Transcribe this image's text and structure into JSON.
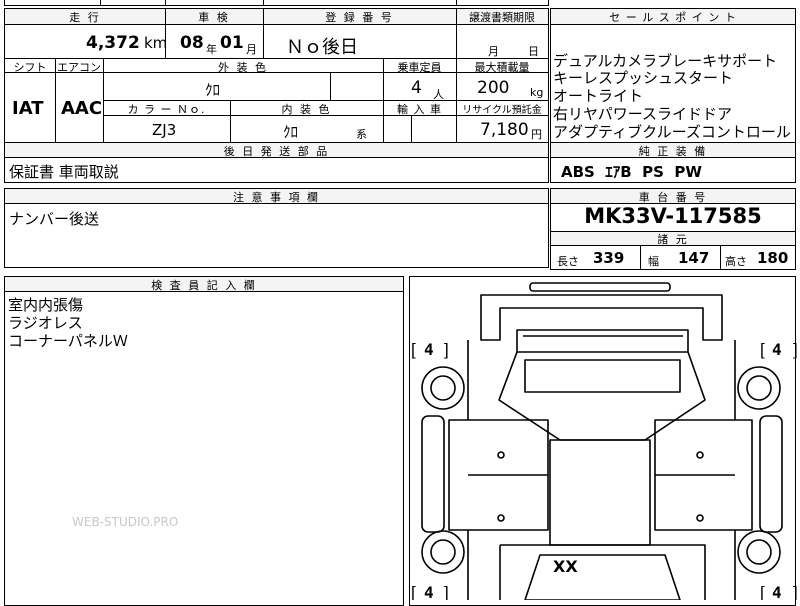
{
  "header": {
    "mileage_label": "走 行",
    "inspection_label": "車 検",
    "registration_label": "登 録 番 号",
    "transfer_label": "譲渡書類期限",
    "sales_point_label": "セ ー ル ス ポ イ ン ト"
  },
  "mileage": {
    "value": "4,372",
    "unit": "km"
  },
  "inspection": {
    "year": "08",
    "year_unit": "年",
    "month": "01",
    "month_unit": "月"
  },
  "registration": {
    "value": "Ｎｏ後日"
  },
  "transfer": {
    "month_unit": "月",
    "day_unit": "日"
  },
  "shift": {
    "label": "シフト",
    "value": "IAT"
  },
  "aircon": {
    "label": "エアコン",
    "value": "AAC"
  },
  "exterior": {
    "label": "外 装 色",
    "value": "ｸﾛ"
  },
  "capacity": {
    "label": "乗車定員",
    "value": "4",
    "unit": "人"
  },
  "max_load": {
    "label": "最大積載量",
    "value": "200",
    "unit": "kg"
  },
  "color_no": {
    "label": "カ ラ ー Ｎｏ.",
    "value": "ZJ3"
  },
  "interior": {
    "label": "内 装 色",
    "value": "ｸﾛ",
    "suffix": "系"
  },
  "import": {
    "label": "輸 入 車"
  },
  "recycle": {
    "label": "リサイクル預託金",
    "value": "7,180",
    "unit": "円"
  },
  "sales_points": [
    "デュアルカメラブレーキサポート",
    "キーレスプッシュスタート",
    "オートライト",
    "右リヤパワースライドドア",
    "アダプティブクルーズコントロール"
  ],
  "later_parts": {
    "label": "後 日 発 送 部 品",
    "value": "保証書 車両取説"
  },
  "genuine": {
    "label": "純 正 装 備",
    "value": "ABS  ｴｱB  PS  PW"
  },
  "notes": {
    "label": "注 意 事 項 欄",
    "value": "ナンバー後送"
  },
  "chassis": {
    "label": "車 台 番 号",
    "value": "MK33V-117585"
  },
  "specs": {
    "label": "諸 元",
    "length_label": "長さ",
    "length": "339",
    "width_label": "幅",
    "width": "147",
    "height_label": "高さ",
    "height": "180"
  },
  "inspector": {
    "label": "検 査 員 記 入 欄",
    "lines": [
      "室内内張傷",
      "ラジオレス",
      "コーナーパネルＷ"
    ]
  },
  "diagram": {
    "tire_tl": "4",
    "tire_tr": "4",
    "tire_bl": "4",
    "tire_br": "4",
    "mark": "XX"
  },
  "watermark": "WEB-STUDIO.PRO"
}
